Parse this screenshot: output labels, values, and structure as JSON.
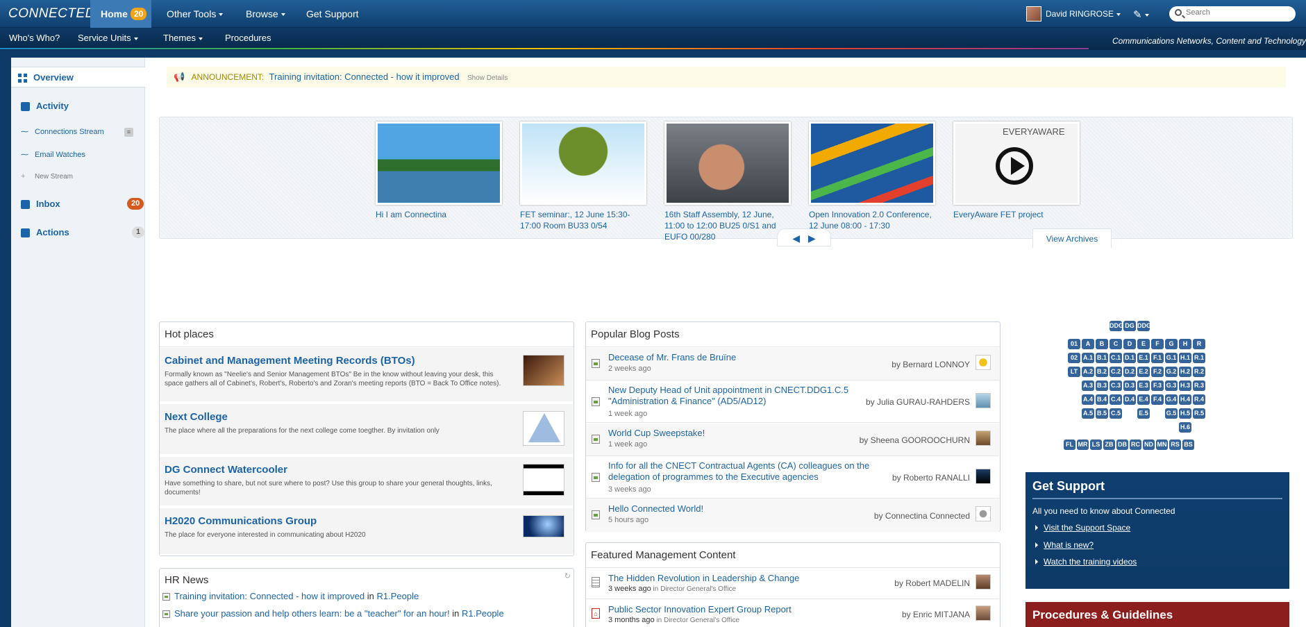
{
  "topbar": {
    "brand": "CONNECTED",
    "home_label": "Home",
    "home_badge": "20",
    "other_tools": "Other Tools",
    "browse": "Browse",
    "get_support": "Get Support",
    "user_name": "David RINGROSE",
    "search_placeholder": "Search"
  },
  "subbar": {
    "whos_who": "Who's Who?",
    "service_units": "Service Units",
    "themes": "Themes",
    "procedures": "Procedures",
    "tagline": "Communications Networks, Content and Technology"
  },
  "sidebar": {
    "overview": "Overview",
    "activity": "Activity",
    "connections_stream": "Connections Stream",
    "email_watches": "Email Watches",
    "new_stream": "New Stream",
    "inbox": "Inbox",
    "inbox_count": "20",
    "actions": "Actions",
    "actions_count": "1"
  },
  "announcement": {
    "label": "ANNOUNCEMENT:",
    "link": "Training invitation: Connected - how it improved",
    "details": "Show Details"
  },
  "carousel": {
    "slides": [
      {
        "caption": "Hi I am Connectina"
      },
      {
        "caption": "FET seminar:, 12 June 15:30-17:00 Room BU33 0/54"
      },
      {
        "caption": "16th Staff Assembly, 12 June, 11:00 to 12:00 BU25 0/S1 and EUFO 00/280"
      },
      {
        "caption": "Open Innovation 2.0 Conference, 12 June 08:00 - 17:30"
      },
      {
        "caption": "EveryAware FET project"
      }
    ],
    "view_archives": "View Archives",
    "slide5_overlay": "EVERYAWARE"
  },
  "hot_places": {
    "title": "Hot places",
    "items": [
      {
        "title": "Cabinet and Management Meeting Records (BTOs)",
        "desc": "Formally known as \"Neelie's and Senior Management BTOs\" Be in the know without leaving your desk, this space gathers all of Cabinet's, Robert's, Roberto's and Zoran's meeting reports (BTO = Back To Office notes)."
      },
      {
        "title": "Next College",
        "desc": "The place where all the preparations for the next college come toegther. By invitation only"
      },
      {
        "title": "DG Connect Watercooler",
        "desc": "Have something to share, but not sure where to post? Use this group to share your general thoughts, links, documents!"
      },
      {
        "title": "H2020 Communications Group",
        "desc": "The place for everyone interested in communicating about H2020"
      }
    ]
  },
  "hr_news": {
    "title": "HR News",
    "items": [
      {
        "text": "Training invitation: Connected - how it improved",
        "in": "in",
        "where": "R1.People"
      },
      {
        "text": "Share your passion and help others learn: be a \"teacher\" for an hour!",
        "in": "in",
        "where": "R1.People"
      }
    ]
  },
  "popular_blog": {
    "title": "Popular Blog Posts",
    "items": [
      {
        "title": "Decease of Mr. Frans de Bruïne",
        "time": "2 weeks ago",
        "by": "by Bernard LONNOY"
      },
      {
        "title": "New Deputy Head of Unit appointment in CNECT.DDG1.C.5 \"Administration & Finance\" (AD5/AD12)",
        "time": "1 week ago",
        "by": "by Julia GURAU-RAHDERS"
      },
      {
        "title": "World Cup Sweepstake!",
        "time": "1 week ago",
        "by": "by Sheena GOOROOCHURN"
      },
      {
        "title": "Info for all the CNECT Contractual Agents (CA) colleagues on the delegation of programmes to the Executive agencies",
        "time": "3 weeks ago",
        "by": "by Roberto RANALLI"
      },
      {
        "title": "Hello Connected World!",
        "time": "5 hours ago",
        "by": "by Connectina Connected"
      }
    ]
  },
  "featured": {
    "title": "Featured Management Content",
    "items": [
      {
        "title": "The Hidden Revolution in Leadership & Change",
        "time": "3 weeks ago",
        "in": "in",
        "where": "Director General's Office",
        "by": "by Robert MADELIN"
      },
      {
        "title": "Public Sector Innovation Expert Group Report",
        "time": "3 months ago",
        "in": "in",
        "where": "Director General's Office",
        "by": "by Enric MITJANA"
      }
    ]
  },
  "org_chart": {
    "row0": [
      "DDG",
      "DG",
      "DDG"
    ],
    "row1": [
      "01",
      "A",
      "B",
      "C",
      "D",
      "E",
      "F",
      "G",
      "H",
      "R"
    ],
    "row2": [
      "02",
      "A.1",
      "B.1",
      "C.1",
      "D.1",
      "E.1",
      "F.1",
      "G.1",
      "H.1",
      "R.1"
    ],
    "row3": [
      "LT",
      "A.2",
      "B.2",
      "C.2",
      "D.2",
      "E.2",
      "F.2",
      "G.2",
      "H.2",
      "R.2"
    ],
    "row4": [
      "A.3",
      "B.3",
      "C.3",
      "D.3",
      "E.3",
      "F.3",
      "G.3",
      "H.3",
      "R.3"
    ],
    "row5": [
      "A.4",
      "B.4",
      "C.4",
      "D.4",
      "E.4",
      "F.4",
      "G.4",
      "H.4",
      "R.4"
    ],
    "row6": [
      "A.5",
      "B.5",
      "C.5",
      "E.5",
      "G.5",
      "H.5",
      "R.5"
    ],
    "row7": [
      "H.6"
    ],
    "row8": [
      "FL",
      "MR",
      "LS",
      "ZB",
      "DB",
      "RC",
      "ND",
      "MN",
      "RS",
      "BS"
    ]
  },
  "get_support": {
    "title": "Get Support",
    "intro": "All you need to know about Connected",
    "links": [
      "Visit the Support Space",
      "What is new?",
      "Watch the training videos"
    ]
  },
  "procedures": {
    "title": "Procedures & Guidelines"
  }
}
